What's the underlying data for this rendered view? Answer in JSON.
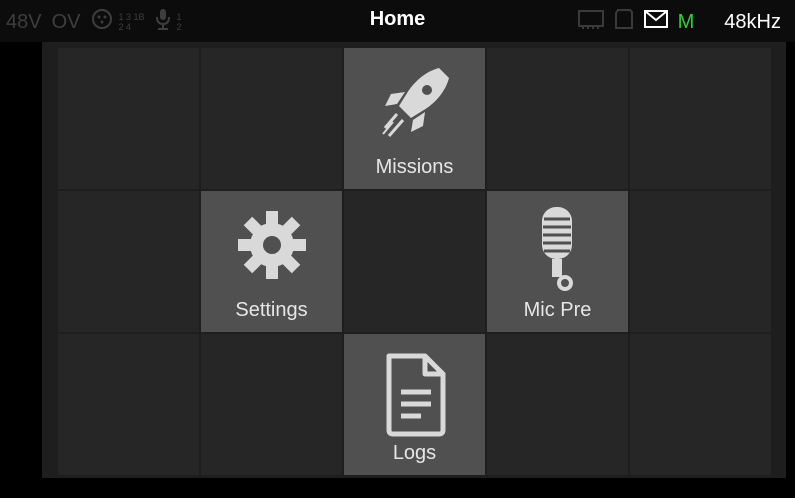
{
  "status": {
    "phantom": "48V",
    "overvoltage": "OV",
    "xlr_routing_top": "1 3 1B",
    "xlr_routing_bottom": "2 4",
    "mic_top": "1",
    "mic_bottom": "2",
    "title": "Home",
    "mode": "M",
    "sample_rate": "48kHz",
    "icons": [
      "xlr-icon",
      "mic-icon",
      "memory-card-icon",
      "sd-card-icon",
      "mail-icon"
    ]
  },
  "colors": {
    "mode_indicator": "#2fcf38",
    "active_tile": "#505050",
    "inactive_tile": "#262626"
  },
  "tiles": [
    {
      "label": ""
    },
    {
      "label": ""
    },
    {
      "label": "Missions",
      "icon": "rocket-icon"
    },
    {
      "label": ""
    },
    {
      "label": ""
    },
    {
      "label": ""
    },
    {
      "label": "Settings",
      "icon": "gear-icon"
    },
    {
      "label": ""
    },
    {
      "label": "Mic Pre",
      "icon": "microphone-icon"
    },
    {
      "label": ""
    },
    {
      "label": ""
    },
    {
      "label": ""
    },
    {
      "label": "Logs",
      "icon": "document-icon"
    },
    {
      "label": ""
    },
    {
      "label": ""
    }
  ]
}
